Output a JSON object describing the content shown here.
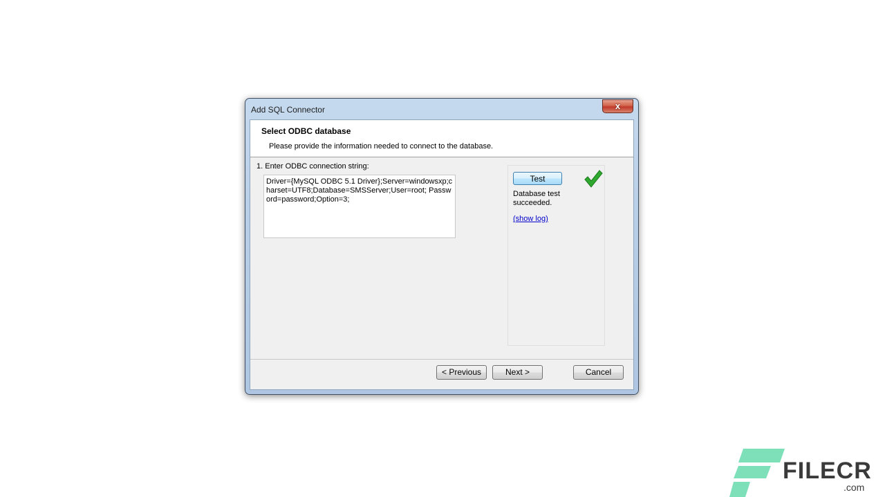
{
  "window": {
    "title": "Add SQL Connector",
    "close_glyph": "x"
  },
  "header": {
    "title": "Select ODBC database",
    "subtitle": "Please provide the information needed to connect to the database."
  },
  "form": {
    "step_label": "1. Enter ODBC connection string:",
    "connection_string": "Driver={MySQL ODBC 5.1 Driver};Server=windowsxp;charset=UTF8;Database=SMSServer;User=root; Password=password;Option=3;"
  },
  "test": {
    "button_label": "Test",
    "result_text": "Database test succeeded.",
    "show_log_label": "(show log)",
    "status_icon": "checkmark-icon",
    "status_color": "#2fa82f"
  },
  "footer": {
    "previous_label": "< Previous",
    "next_label": "Next >",
    "cancel_label": "Cancel"
  },
  "watermark": {
    "brand": "FILECR",
    "domain": ".com",
    "color": "#7ee0b8"
  }
}
